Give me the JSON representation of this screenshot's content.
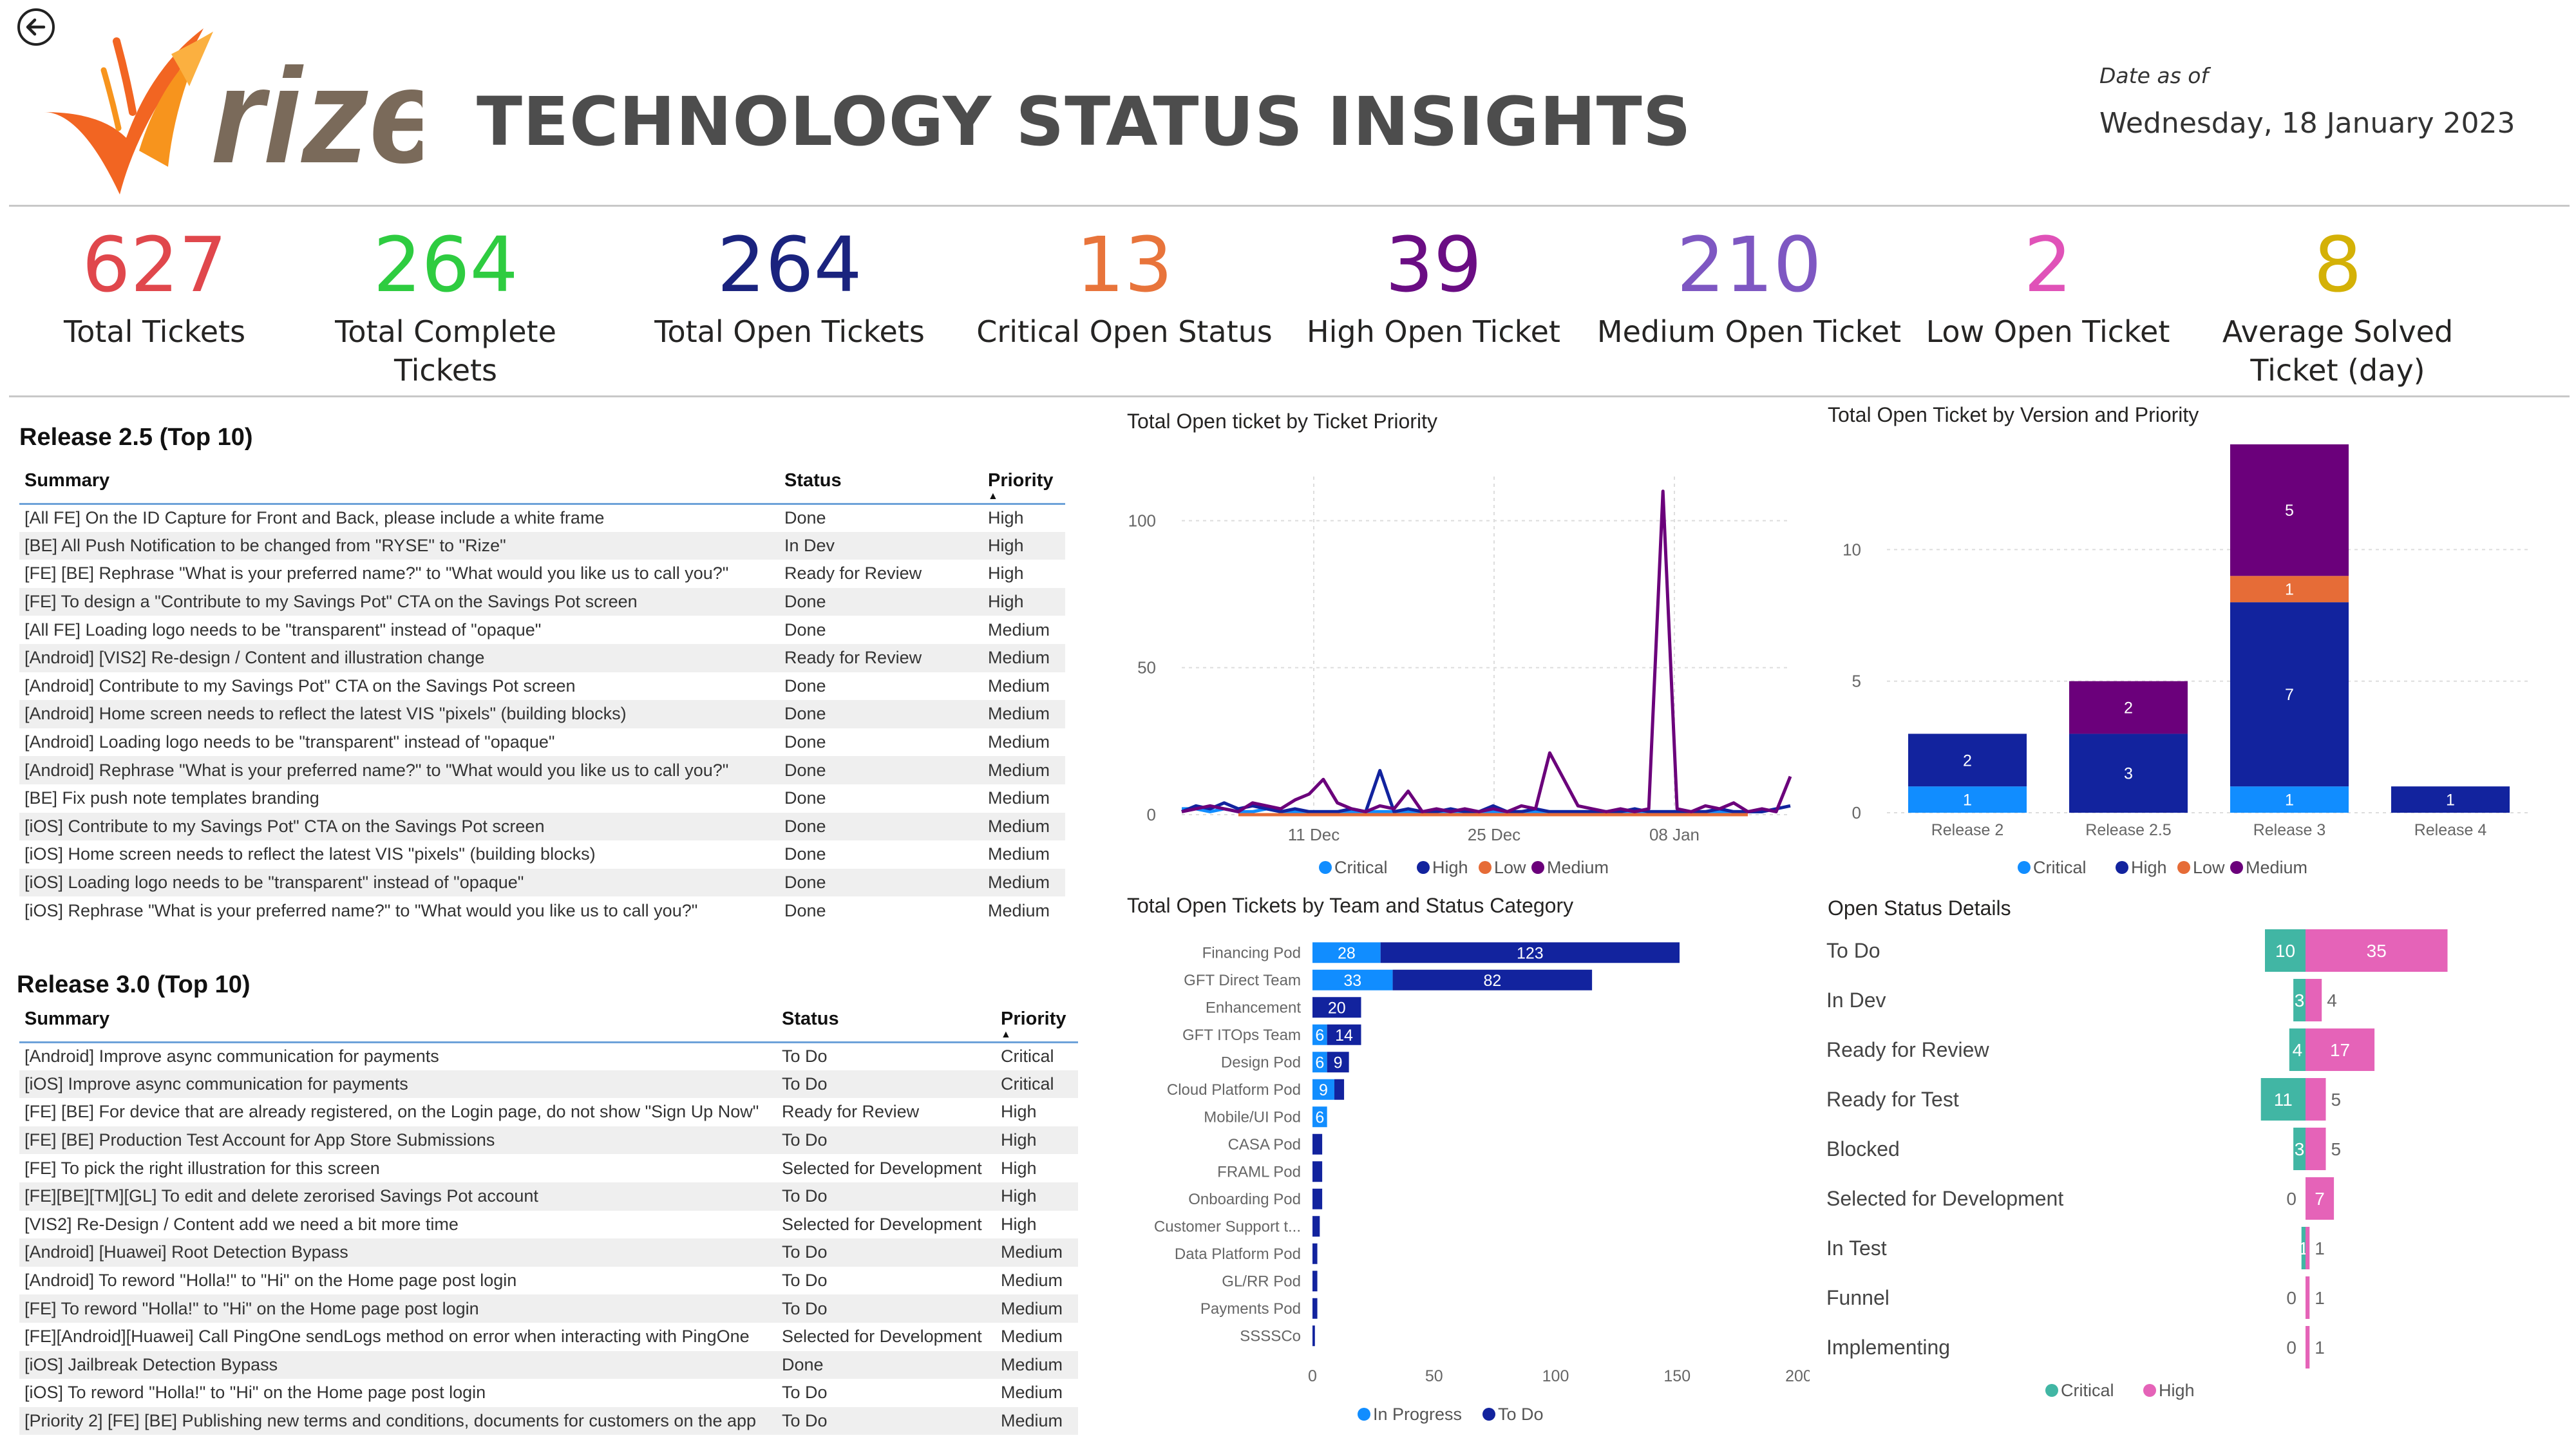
{
  "header": {
    "brand": "rize",
    "title": "TECHNOLOGY STATUS INSIGHTS",
    "date_label": "Date as of",
    "date_value": "Wednesday, 18 January 2023",
    "icons": {
      "back": "back-arrow-icon"
    }
  },
  "kpis": [
    {
      "value": "627",
      "label": "Total Tickets",
      "color": "#e0474c"
    },
    {
      "value": "264",
      "label": "Total Complete Tickets",
      "color": "#2ecc40"
    },
    {
      "value": "264",
      "label": "Total Open Tickets",
      "color": "#1a237e"
    },
    {
      "value": "13",
      "label": "Critical Open Status",
      "color": "#e8743b"
    },
    {
      "value": "39",
      "label": "High Open Ticket",
      "color": "#6a0d83"
    },
    {
      "value": "210",
      "label": "Medium Open Ticket",
      "color": "#7e57c2"
    },
    {
      "value": "2",
      "label": "Low Open Ticket",
      "color": "#e052b8"
    },
    {
      "value": "8",
      "label": "Average Solved Ticket (day)",
      "color": "#d4b106"
    }
  ],
  "release25": {
    "title": "Release 2.5 (Top 10)",
    "columns": [
      "Summary",
      "Status",
      "Priority"
    ],
    "rows": [
      [
        "[All FE] On the ID Capture for Front and Back, please include a white frame",
        "Done",
        "High"
      ],
      [
        "[BE] All Push Notification to be changed from \"RYSE\" to \"Rize\"",
        "In Dev",
        "High"
      ],
      [
        "[FE] [BE] Rephrase \"What is your preferred name?\" to \"What would you like us to call you?\"",
        "Ready for Review",
        "High"
      ],
      [
        "[FE] To design a \"Contribute to my Savings Pot\" CTA on the Savings Pot screen",
        "Done",
        "High"
      ],
      [
        "[All FE] Loading logo needs to be \"transparent\" instead of \"opaque\"",
        "Done",
        "Medium"
      ],
      [
        "[Android] [VIS2] Re-design / Content and illustration change",
        "Ready for Review",
        "Medium"
      ],
      [
        "[Android] Contribute to my Savings Pot\" CTA on the Savings Pot screen",
        "Done",
        "Medium"
      ],
      [
        "[Android] Home screen needs to reflect the latest VIS \"pixels\" (building blocks)",
        "Done",
        "Medium"
      ],
      [
        "[Android] Loading logo needs to be \"transparent\" instead of \"opaque\"",
        "Done",
        "Medium"
      ],
      [
        "[Android] Rephrase \"What is your preferred name?\" to \"What would you like us to call you?\"",
        "Done",
        "Medium"
      ],
      [
        "[BE] Fix push note templates branding",
        "Done",
        "Medium"
      ],
      [
        "[iOS] Contribute to my Savings Pot\" CTA on the Savings Pot screen",
        "Done",
        "Medium"
      ],
      [
        "[iOS] Home screen needs to reflect the latest VIS \"pixels\" (building blocks)",
        "Done",
        "Medium"
      ],
      [
        "[iOS] Loading logo needs to be \"transparent\" instead of \"opaque\"",
        "Done",
        "Medium"
      ],
      [
        "[iOS] Rephrase \"What is your preferred name?\" to \"What would you like us to call you?\"",
        "Done",
        "Medium"
      ]
    ]
  },
  "release30": {
    "title": "Release 3.0 (Top 10)",
    "columns": [
      "Summary",
      "Status",
      "Priority"
    ],
    "rows": [
      [
        "[Android] Improve async communication for payments",
        "To Do",
        "Critical"
      ],
      [
        "[iOS] Improve async communication for payments",
        "To Do",
        "Critical"
      ],
      [
        "[FE] [BE] For device that are already registered, on the Login page, do not show \"Sign Up Now\"",
        "Ready for Review",
        "High"
      ],
      [
        "[FE] [BE] Production Test Account for App Store Submissions",
        "To Do",
        "High"
      ],
      [
        "[FE] To pick the right illustration for this screen",
        "Selected for Development",
        "High"
      ],
      [
        "[FE][BE][TM][GL] To edit and delete zerorised Savings Pot account",
        "To Do",
        "High"
      ],
      [
        "[VIS2] Re-Design / Content add we need a bit more time",
        "Selected for Development",
        "High"
      ],
      [
        "[Android] [Huawei] Root Detection Bypass",
        "To Do",
        "Medium"
      ],
      [
        "[Android] To reword \"Holla!\" to \"Hi\" on the Home page post login",
        "To Do",
        "Medium"
      ],
      [
        "[FE] To reword \"Holla!\" to \"Hi\" on the Home page post login",
        "To Do",
        "Medium"
      ],
      [
        "[FE][Android][Huawei] Call PingOne sendLogs method on error when interacting with PingOne",
        "Selected for Development",
        "Medium"
      ],
      [
        "[iOS] Jailbreak Detection Bypass",
        "Done",
        "Medium"
      ],
      [
        "[iOS] To reword \"Holla!\" to \"Hi\" on the Home page post login",
        "To Do",
        "Medium"
      ],
      [
        "[Priority 2] [FE] [BE] Publishing new terms and conditions, documents for customers on the app",
        "To Do",
        "Medium"
      ]
    ]
  },
  "chart_data": [
    {
      "type": "line",
      "title": "Total Open ticket by Ticket Priority",
      "x_ticks": [
        "11 Dec",
        "25 Dec",
        "08 Jan"
      ],
      "y_ticks": [
        0,
        50,
        100
      ],
      "ylim": [
        0,
        115
      ],
      "legend": "bottom",
      "series": [
        {
          "name": "Critical",
          "color": "#118dff",
          "values": [
            2,
            2,
            1,
            2,
            1,
            1,
            2,
            1,
            1,
            1,
            1,
            1,
            1,
            1,
            1,
            1,
            1,
            1,
            1,
            1,
            1,
            1,
            1,
            1,
            1,
            1,
            1,
            1,
            1,
            1,
            1,
            1,
            1,
            1,
            1,
            1,
            1,
            1,
            1,
            1,
            1,
            1,
            1,
            1
          ]
        },
        {
          "name": "High",
          "color": "#12239e",
          "values": [
            1,
            3,
            2,
            4,
            2,
            3,
            2,
            1,
            2,
            1,
            1,
            1,
            2,
            1,
            15,
            1,
            2,
            1,
            1,
            2,
            1,
            1,
            3,
            1,
            1,
            2,
            1,
            1,
            1,
            1,
            1,
            1,
            2,
            1,
            1,
            1,
            1,
            1,
            2,
            1,
            1,
            1,
            2,
            3
          ]
        },
        {
          "name": "Low",
          "color": "#e66c37",
          "values": [
            0,
            0,
            0,
            0,
            0,
            0,
            0,
            0,
            0,
            0,
            0,
            0,
            0,
            0,
            0,
            0,
            0,
            0,
            0,
            0,
            0,
            0,
            0,
            0,
            0,
            0,
            0,
            0,
            0,
            0,
            0,
            0,
            0,
            0,
            0,
            0,
            0,
            0,
            0,
            0,
            0,
            0,
            0,
            0
          ]
        },
        {
          "name": "Medium",
          "color": "#6b007b",
          "values": [
            1,
            2,
            3,
            2,
            1,
            4,
            3,
            2,
            5,
            7,
            12,
            4,
            2,
            1,
            3,
            2,
            8,
            1,
            2,
            1,
            2,
            1,
            2,
            1,
            3,
            2,
            21,
            12,
            3,
            2,
            1,
            2,
            1,
            2,
            110,
            2,
            1,
            3,
            2,
            4,
            1,
            2,
            1,
            13
          ]
        }
      ]
    },
    {
      "type": "bar",
      "stacked": true,
      "title": "Total Open Ticket by Version and Priority",
      "categories": [
        "Release 2",
        "Release 2.5",
        "Release 3",
        "Release 4"
      ],
      "y_ticks": [
        0,
        5,
        10
      ],
      "ylim": [
        0,
        14
      ],
      "legend": "bottom",
      "series": [
        {
          "name": "Critical",
          "color": "#118dff",
          "values": [
            1,
            0,
            1,
            0
          ]
        },
        {
          "name": "High",
          "color": "#12239e",
          "values": [
            2,
            3,
            7,
            1
          ]
        },
        {
          "name": "Low",
          "color": "#e66c37",
          "values": [
            0,
            0,
            1,
            0
          ]
        },
        {
          "name": "Medium",
          "color": "#6b007b",
          "values": [
            0,
            2,
            5,
            0
          ]
        }
      ]
    },
    {
      "type": "bar",
      "orientation": "horizontal",
      "stacked": true,
      "title": "Total Open Tickets by Team and Status Category",
      "categories": [
        "Financing Pod",
        "GFT Direct Team",
        "Enhancement",
        "GFT ITOps Team",
        "Design Pod",
        "Cloud Platform Pod",
        "Mobile/UI Pod",
        "CASA Pod",
        "FRAML Pod",
        "Onboarding Pod",
        "Customer Support t...",
        "Data Platform Pod",
        "GL/RR Pod",
        "Payments Pod",
        "SSSSCo"
      ],
      "x_ticks": [
        0,
        50,
        100,
        150,
        200
      ],
      "xlim": [
        0,
        200
      ],
      "legend": "bottom",
      "series": [
        {
          "name": "In Progress",
          "color": "#118dff",
          "values": [
            28,
            33,
            0,
            6,
            6,
            9,
            6,
            0,
            0,
            0,
            0,
            0,
            0,
            0,
            0
          ]
        },
        {
          "name": "To Do",
          "color": "#12239e",
          "values": [
            123,
            82,
            20,
            14,
            9,
            4,
            0,
            4,
            4,
            4,
            3,
            2,
            2,
            2,
            1
          ]
        }
      ],
      "labels": {
        "In Progress": [
          "28",
          "33",
          "",
          "6",
          "6",
          "9",
          "6",
          "",
          "",
          "",
          "",
          "",
          "",
          "",
          ""
        ],
        "To Do": [
          "123",
          "82",
          "20",
          "14",
          "9",
          "",
          "",
          "",
          "",
          "",
          "",
          "",
          "",
          "",
          ""
        ]
      }
    },
    {
      "type": "bar",
      "orientation": "horizontal",
      "diverging": true,
      "title": "Open Status Details",
      "categories": [
        "To Do",
        "In Dev",
        "Ready for Review",
        "Ready for Test",
        "Blocked",
        "Selected for Development",
        "In Test",
        "Funnel",
        "Implementing"
      ],
      "legend": "bottom",
      "series": [
        {
          "name": "Critical",
          "color": "#41b6a4",
          "values": [
            10,
            3,
            4,
            11,
            3,
            0,
            1,
            0,
            0
          ]
        },
        {
          "name": "High",
          "color": "#e563b8",
          "values": [
            35,
            4,
            17,
            5,
            5,
            7,
            1,
            1,
            1
          ]
        }
      ]
    }
  ]
}
